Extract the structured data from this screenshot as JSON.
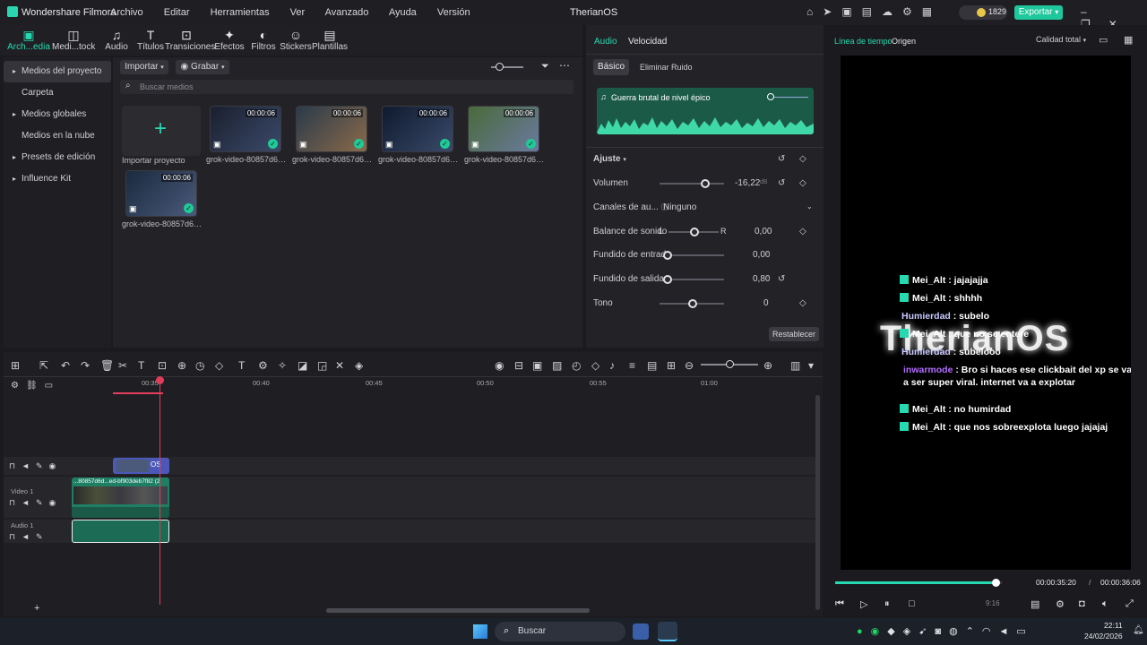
{
  "app": {
    "name": "Wondershare Filmora",
    "project": "TherianOS",
    "menu": [
      "Archivo",
      "Editar",
      "Herramientas",
      "Ver",
      "Avanzado",
      "Ayuda",
      "Versión"
    ],
    "credits": "1829",
    "export": "Exportar"
  },
  "toolbar": [
    {
      "label": "Arch...edia",
      "icon": "▣"
    },
    {
      "label": "Medi...tock",
      "icon": "◫"
    },
    {
      "label": "Audio",
      "icon": "♫"
    },
    {
      "label": "Títulos",
      "icon": "T"
    },
    {
      "label": "Transiciones",
      "icon": "⊡"
    },
    {
      "label": "Efectos",
      "icon": "✦"
    },
    {
      "label": "Filtros",
      "icon": "◐"
    },
    {
      "label": "Stickers",
      "icon": "☺"
    },
    {
      "label": "Plantillas",
      "icon": "▤"
    }
  ],
  "sidebar": [
    {
      "label": "Medios del proyecto",
      "arrow": "▸"
    },
    {
      "label": "Carpeta",
      "arrow": ""
    },
    {
      "label": "Medios globales",
      "arrow": "▸"
    },
    {
      "label": "Medios en la nube",
      "arrow": ""
    },
    {
      "label": "Presets de edición",
      "arrow": "▸"
    },
    {
      "label": "Influence Kit",
      "arrow": "▸"
    }
  ],
  "media": {
    "import_btn": "Importar",
    "record_btn": "Grabar",
    "search_placeholder": "Buscar medios",
    "import_label": "Importar proyecto",
    "items": [
      {
        "name": "grok-video-80857d6d-...",
        "duration": "00:00:06"
      },
      {
        "name": "grok-video-80857d6d-...",
        "duration": "00:00:06"
      },
      {
        "name": "grok-video-80857d6d-...",
        "duration": "00:00:06"
      },
      {
        "name": "grok-video-80857d6d-...",
        "duration": "00:00:06"
      },
      {
        "name": "grok-video-80857d6d-...",
        "duration": "00:00:06"
      }
    ]
  },
  "props": {
    "tabs": [
      "Audio",
      "Velocidad"
    ],
    "subtabs": [
      "Básico",
      "Eliminar Ruido"
    ],
    "track": "Guerra brutal de nivel épico",
    "section": "Ajuste",
    "volume": {
      "label": "Volumen",
      "value": "-16,22",
      "unit": "dB"
    },
    "channels": {
      "label": "Canales de au...",
      "value": "Ninguno"
    },
    "balance": {
      "label": "Balance de sonido",
      "l": "L",
      "r": "R",
      "value": "0,00"
    },
    "fade_in": {
      "label": "Fundido de entrada",
      "value": "0,00",
      "unit": "s"
    },
    "fade_out": {
      "label": "Fundido  de salida",
      "value": "0,80",
      "unit": "s"
    },
    "tone": {
      "label": "Tono",
      "value": "0"
    },
    "reset": "Restablecer"
  },
  "preview": {
    "tabs": [
      "Línea de tiempo",
      "Origen"
    ],
    "quality": "Calidad total",
    "watermark": "TherianOS",
    "chat": [
      {
        "user": "Mei_Alt",
        "msg": ": jajajajja",
        "color": "#ffffff",
        "badge": true
      },
      {
        "user": "Mei_Alt",
        "msg": ": shhhh",
        "color": "#ffffff",
        "badge": true
      },
      {
        "user": "Humierdad",
        "msg": ": subelo",
        "color": "#c9c9ff",
        "badge": false
      },
      {
        "user": "Mei_Alt",
        "msg": ": que no se entere",
        "color": "#ffffff",
        "badge": true
      },
      {
        "user": "Humierdad",
        "msg": ": subelooo",
        "color": "#c9c9ff",
        "badge": false
      },
      {
        "user": "inwarmode",
        "msg": ": Bro si haces ese clickbait del xp se va a ser super viral. internet va a explotar",
        "color": "#b46cff",
        "badge": false
      },
      {
        "user": "Mei_Alt",
        "msg": ": no humirdad",
        "color": "#ffffff",
        "badge": true
      },
      {
        "user": "Mei_Alt",
        "msg": ": que nos sobreexplota luego jajajaj",
        "color": "#ffffff",
        "badge": true
      }
    ],
    "progress": 0.96,
    "time_current": "00:00:35:20",
    "time_sep": "/",
    "time_total": "00:00:36:06",
    "ratio": "9:16"
  },
  "timeline": {
    "ruler": [
      "00:35",
      "00:40",
      "00:45",
      "00:50",
      "00:55",
      "01:00"
    ],
    "tracks": [
      "Video 1",
      "Audio 1"
    ],
    "clip_top": "OS",
    "clip_video": "...80857d6d...ed-bf903deb7f82 (2"
  },
  "taskbar": {
    "search": "Buscar",
    "time": "22:11",
    "date": "24/02/2026"
  }
}
